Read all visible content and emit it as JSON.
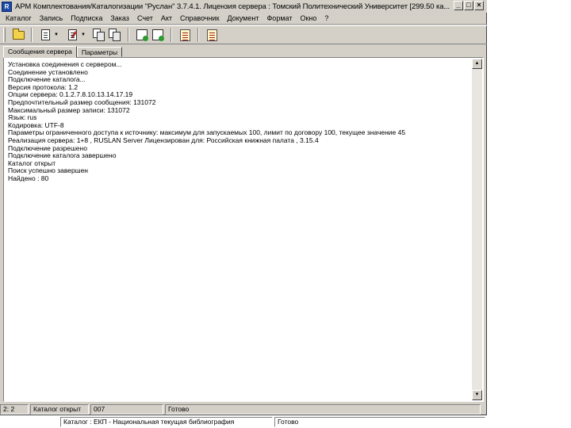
{
  "window": {
    "title": "АРМ Комплектования/Каталогизации \"Руслан\" 3.7.4.1. Лицензия сервера : Томский Политехнический Университет  [299.50 ка..."
  },
  "menu": {
    "items": [
      "Каталог",
      "Запись",
      "Подписка",
      "Заказ",
      "Счет",
      "Акт",
      "Справочник",
      "Документ",
      "Формат",
      "Окно",
      "?"
    ]
  },
  "tabs": {
    "messages": "Сообщения сервера",
    "parameters": "Параметры"
  },
  "log": {
    "lines": [
      "Установка соединения с сервером...",
      "Соединение установлено",
      "Подключение каталога...",
      "Версия протокола: 1.2",
      "Опции сервера: 0.1.2.7.8.10.13.14.17.19",
      "Предпочтительный размер сообщения: 131072",
      "Максимальный размер записи: 131072",
      "Язык: rus",
      "Кодировка: UTF-8",
      "Параметры ограниченного доступа к источнику: максимум для запускаемых 100, лимит по договору 100, текущее значение 45",
      "Реализация сервера: 1+8 , RUSLAN Server Лицензирован для: Российская книжная палата , 3.15.4",
      "Подключение разрешено",
      "Подключение каталога завершено",
      "Каталог открыт",
      "Поиск успешно завершен",
      "Найдено : 80"
    ]
  },
  "status": {
    "row1": {
      "position": "2: 2",
      "catalog_state": "Каталог открыт",
      "count": "007",
      "ready": "Готово"
    },
    "row2": {
      "catalog": "Каталог : ЕКП - Национальная текущая библиография",
      "ready": "Готово"
    }
  }
}
